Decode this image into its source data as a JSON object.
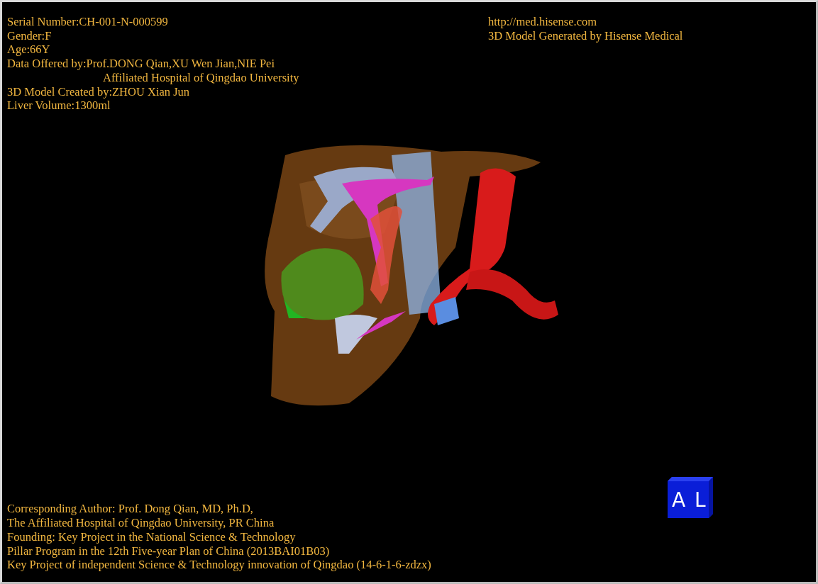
{
  "info_left": [
    {
      "kind": "line",
      "text": "Serial Number:CH-001-N-000599"
    },
    {
      "kind": "line",
      "text": "Gender:F"
    },
    {
      "kind": "line",
      "text": "Age:66Y"
    },
    {
      "kind": "line",
      "text": "Data Offered by:Prof.DONG Qian,XU Wen Jian,NIE Pei"
    },
    {
      "kind": "continuation",
      "text": "Affiliated Hospital of Qingdao University"
    },
    {
      "kind": "line",
      "text": "3D Model Created by:ZHOU Xian Jun"
    },
    {
      "kind": "line",
      "text": "Liver Volume:1300ml"
    }
  ],
  "info_right": [
    "http://med.hisense.com",
    "3D Model Generated by Hisense Medical"
  ],
  "footer": [
    "Corresponding Author: Prof. Dong Qian, MD, Ph.D,",
    "The Affiliated Hospital of Qingdao University, PR China",
    "Founding: Key Project in the National Science & Technology",
    "Pillar Program in the 12th Five-year Plan of China (2013BAI01B03)",
    "Key Project of independent Science & Technology innovation of Qingdao (14-6-1-6-zdzx)"
  ],
  "orientation_cube": {
    "faces": [
      "A",
      "L"
    ]
  }
}
